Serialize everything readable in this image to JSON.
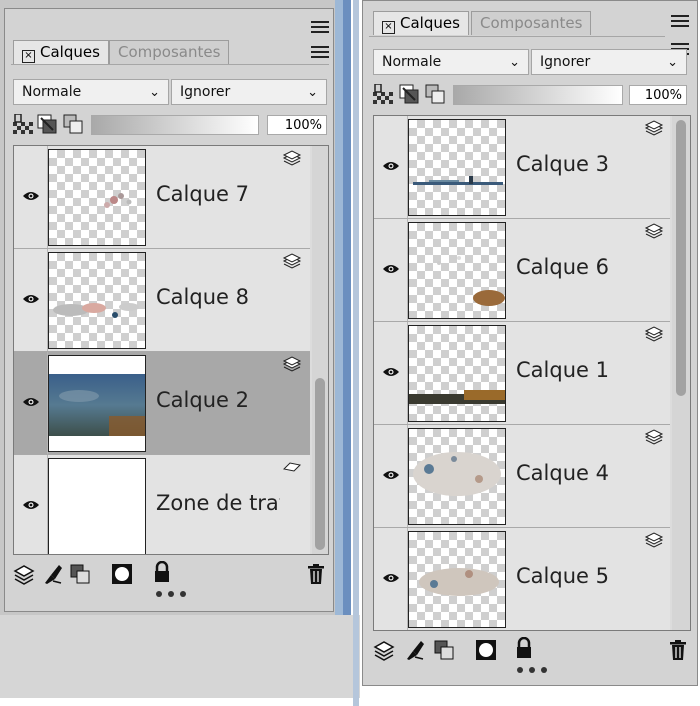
{
  "colors": {
    "panel_bg": "#d3d3d3",
    "selected_row": "#a8a8a8",
    "row_bg": "#e3e3e3",
    "window_blue": "#9db8d6"
  },
  "panel_left": {
    "tabs": [
      {
        "label": "Calques",
        "active": true
      },
      {
        "label": "Composantes",
        "active": false
      }
    ],
    "blend_mode": "Normale",
    "blend_option": "Ignorer",
    "opacity": "100%",
    "layers": [
      {
        "name": "Calque 7",
        "selected": false,
        "thumb": "checker"
      },
      {
        "name": "Calque 8",
        "selected": false,
        "thumb": "checker"
      },
      {
        "name": "Calque 2",
        "selected": true,
        "thumb": "landscape"
      },
      {
        "name": "Zone de trav",
        "selected": false,
        "thumb": "white"
      }
    ]
  },
  "panel_right": {
    "tabs": [
      {
        "label": "Calques",
        "active": true
      },
      {
        "label": "Composantes",
        "active": false
      }
    ],
    "blend_mode": "Normale",
    "blend_option": "Ignorer",
    "opacity": "100%",
    "layers": [
      {
        "name": "Calque 3",
        "selected": false,
        "thumb": "checker"
      },
      {
        "name": "Calque 6",
        "selected": false,
        "thumb": "checker"
      },
      {
        "name": "Calque 1",
        "selected": false,
        "thumb": "checker"
      },
      {
        "name": "Calque 4",
        "selected": false,
        "thumb": "checker"
      },
      {
        "name": "Calque 5",
        "selected": false,
        "thumb": "checker"
      }
    ]
  },
  "icons": {
    "tab_close": "close-box-icon",
    "panel_menu": "hamburger-menu-icon",
    "lock_transparency": "lock-transparency-icon",
    "visibility": "eye-icon",
    "layer_type": "layer-stack-icon",
    "bottom_toolbar": [
      "layers-icon",
      "effects-brush-icon",
      "adjustment-layers-icon",
      "mask-icon",
      "lock-icon",
      "trash-icon"
    ]
  }
}
